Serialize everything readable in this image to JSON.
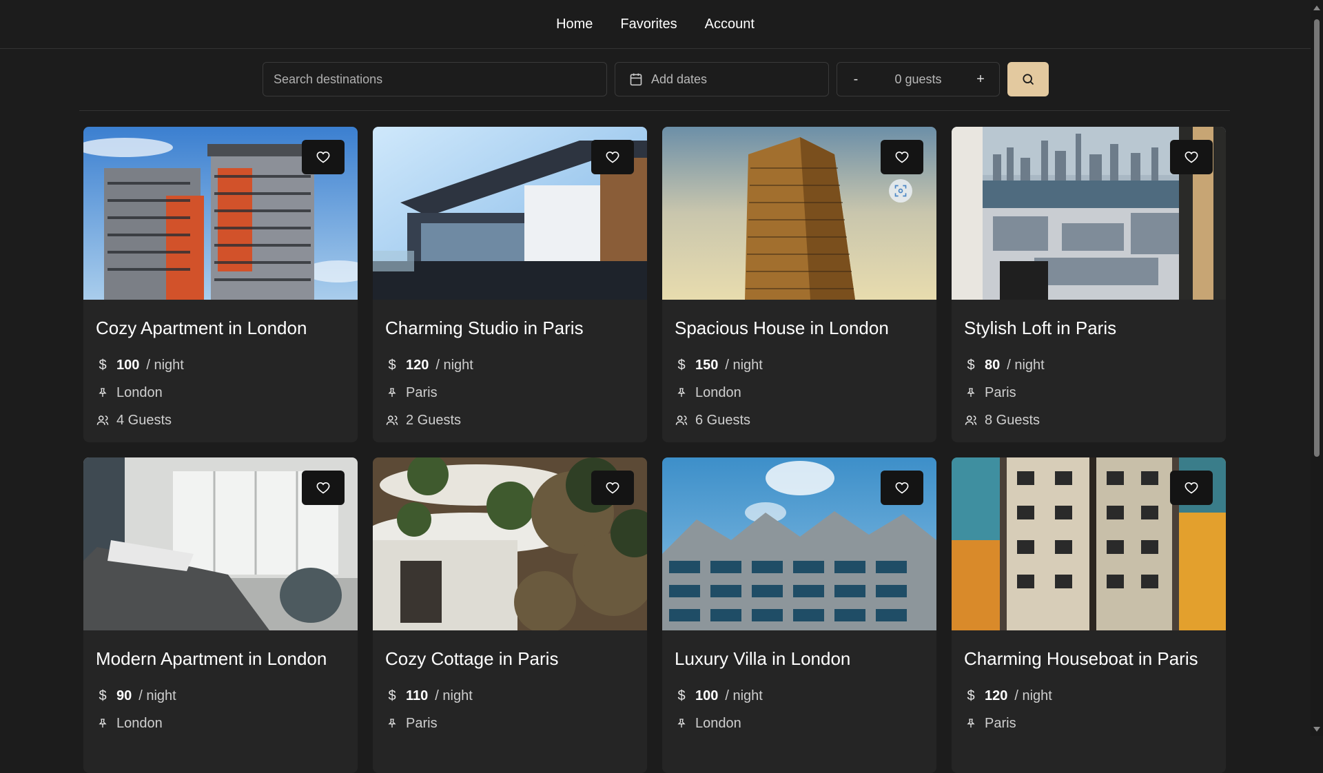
{
  "nav": {
    "items": [
      "Home",
      "Favorites",
      "Account"
    ]
  },
  "search": {
    "destination_placeholder": "Search destinations",
    "dates_label": "Add dates",
    "guests_minus": "-",
    "guests_value": "0 guests",
    "guests_plus": "+"
  },
  "listings": [
    {
      "title": "Cozy Apartment in London",
      "price": "100",
      "per": "/ night",
      "city": "London",
      "guests": "4 Guests",
      "image_icon": "apartment-building-photo"
    },
    {
      "title": "Charming Studio in Paris",
      "price": "120",
      "per": "/ night",
      "city": "Paris",
      "guests": "2 Guests",
      "image_icon": "modern-house-photo"
    },
    {
      "title": "Spacious House in London",
      "price": "150",
      "per": "/ night",
      "city": "London",
      "guests": "6 Guests",
      "image_icon": "tower-photo"
    },
    {
      "title": "Stylish Loft in Paris",
      "price": "80",
      "per": "/ night",
      "city": "Paris",
      "guests": "8 Guests",
      "image_icon": "city-view-photo"
    },
    {
      "title": "Modern Apartment in London",
      "price": "90",
      "per": "/ night",
      "city": "London",
      "guests": "",
      "image_icon": "bedroom-photo"
    },
    {
      "title": "Cozy Cottage in Paris",
      "price": "110",
      "per": "/ night",
      "city": "Paris",
      "guests": "",
      "image_icon": "garden-balcony-photo"
    },
    {
      "title": "Luxury Villa in London",
      "price": "100",
      "per": "/ night",
      "city": "London",
      "guests": "",
      "image_icon": "zigzag-building-photo"
    },
    {
      "title": "Charming Houseboat in Paris",
      "price": "120",
      "per": "/ night",
      "city": "Paris",
      "guests": "",
      "image_icon": "colorful-flats-photo"
    }
  ],
  "colors": {
    "background": "#1c1c1c",
    "card": "#252525",
    "accent": "#e3c99f"
  }
}
